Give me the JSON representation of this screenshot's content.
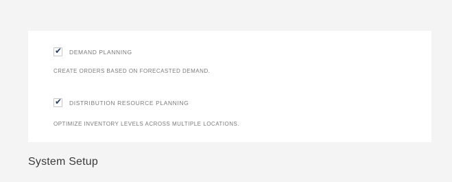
{
  "options": [
    {
      "label": "DEMAND PLANNING",
      "description": "CREATE ORDERS BASED ON FORECASTED DEMAND.",
      "checked": true,
      "check_icon": "checkmark-icon"
    },
    {
      "label": "DISTRIBUTION RESOURCE PLANNING",
      "description": "OPTIMIZE INVENTORY LEVELS ACROSS MULTIPLE LOCATIONS.",
      "checked": true,
      "check_icon": "checkmark-icon"
    }
  ],
  "footer": {
    "title": "System Setup"
  },
  "colors": {
    "background": "#f4f4f5",
    "panel": "#ffffff",
    "check": "#1f3a6d",
    "text_muted": "#7a7a7a"
  }
}
